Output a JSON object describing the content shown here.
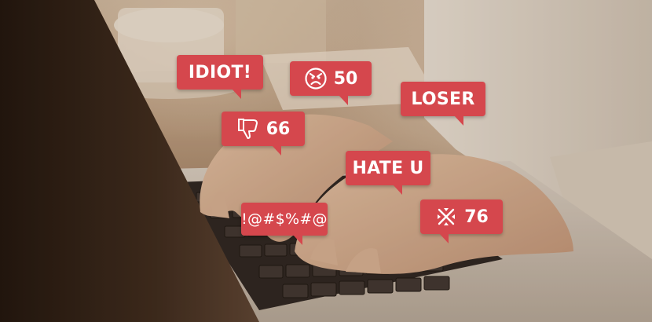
{
  "photo": {
    "subject": "hands-typing-on-laptop",
    "palette": {
      "bubble": "#d5474d",
      "bubble_text": "#ffffff",
      "tone": "#b89a7e"
    }
  },
  "bubbles": {
    "idiot": {
      "text": "IDIOT!"
    },
    "angry": {
      "icon": "angry-face-icon",
      "count": "50"
    },
    "loser": {
      "text": "LOSER"
    },
    "dislike": {
      "icon": "thumbs-down-icon",
      "count": "66"
    },
    "hate": {
      "text": "HATE U"
    },
    "symbols": {
      "text": "!@#$%#@"
    },
    "block": {
      "icon": "cross-arrows-icon",
      "count": "76"
    }
  }
}
